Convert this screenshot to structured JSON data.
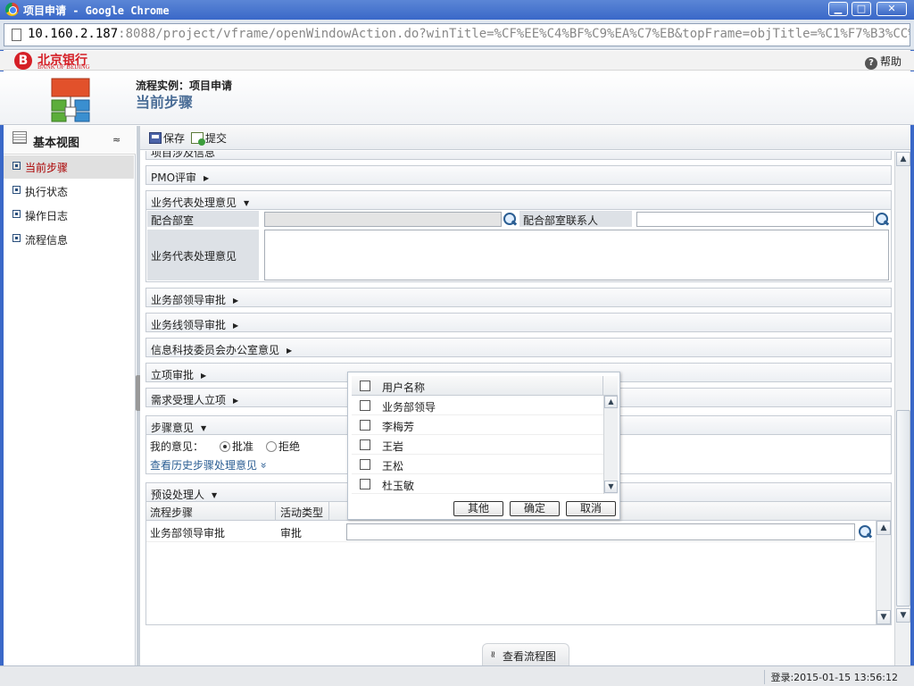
{
  "window": {
    "title": "项目申请 - Google Chrome",
    "min": "▁",
    "max": "□",
    "close": "✕"
  },
  "address": {
    "host": "10.160.2.187",
    "rest": ":8088/project/vframe/openWindowAction.do?winTitle=%CF%EE%C4%BF%C9%EA%C7%EB&topFrame=objTitle=%C1%F7%B3%CC%CA%B5%C0%FD"
  },
  "bank": {
    "mark": "B",
    "name_cn": "北京银行",
    "name_en": "BANK OF BEIJING",
    "help": "帮助",
    "help_icon": "?"
  },
  "header": {
    "line1": "流程实例：项目申请",
    "line2": "当前步骤"
  },
  "sidebar": {
    "title": "基本视图",
    "collapse": "≈",
    "items": [
      {
        "label": "当前步骤",
        "active": true
      },
      {
        "label": "执行状态"
      },
      {
        "label": "操作日志"
      },
      {
        "label": "流程信息"
      }
    ]
  },
  "toolbar": {
    "save": "保存",
    "submit": "提交"
  },
  "sections": {
    "top_partial": "项目涉及信息",
    "pmo": "PMO评审",
    "biz_rep": "业务代表处理意见",
    "biz_leader": "业务部领导审批",
    "line_leader": "业务线领导审批",
    "it_office": "信息科技委员会办公室意见",
    "approve": "立项审批",
    "req_accept": "需求受理人立项",
    "step_opinion": "步骤意见",
    "preset": "预设处理人"
  },
  "biz_rep_form": {
    "dept_label": "配合部室",
    "contact_label": "配合部室联系人",
    "opinion_label": "业务代表处理意见"
  },
  "opinion": {
    "label": "我的意见：",
    "approve": "批准",
    "reject": "拒绝",
    "history": "查看历史步骤处理意见",
    "history_icon": "»"
  },
  "preset_table": {
    "headers": [
      "流程步骤",
      "活动类型"
    ],
    "row": {
      "step": "业务部领导审批",
      "type": "审批"
    }
  },
  "popup": {
    "header": "用户名称",
    "users": [
      "业务部领导",
      "李梅芳",
      "王岩",
      "王松",
      "杜玉敏"
    ],
    "buttons": {
      "other": "其他",
      "ok": "确定",
      "cancel": "取消"
    }
  },
  "flow_button": "查看流程图",
  "flow_icon": "≈",
  "status": "登录:2015-01-15 13:56:12",
  "colors": {
    "title_blue": "#3a68c8",
    "bank_red": "#d51f26",
    "active_text": "#aa0000"
  }
}
